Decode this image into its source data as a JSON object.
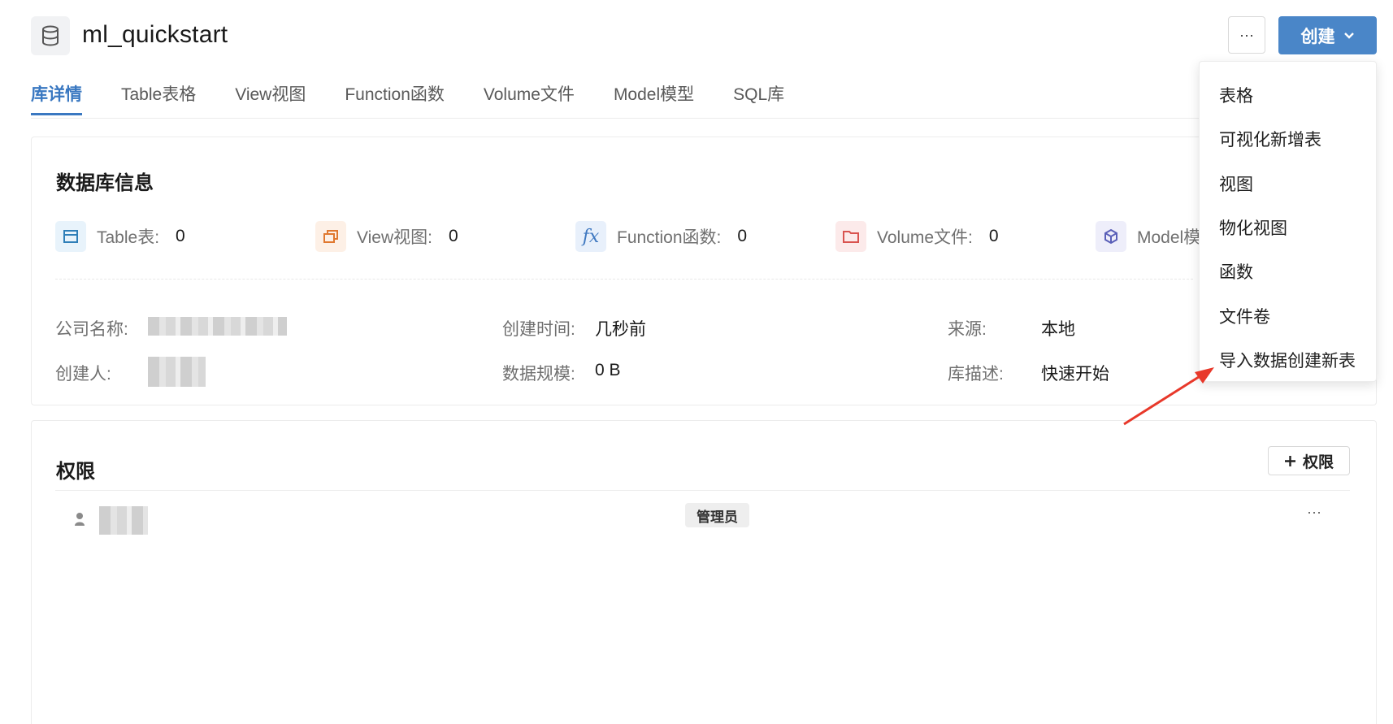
{
  "header": {
    "title": "ml_quickstart",
    "more_label": "···",
    "create_label": "创建"
  },
  "tabs": [
    {
      "label": "库详情",
      "active": true
    },
    {
      "label": "Table表格",
      "active": false
    },
    {
      "label": "View视图",
      "active": false
    },
    {
      "label": "Function函数",
      "active": false
    },
    {
      "label": "Volume文件",
      "active": false
    },
    {
      "label": "Model模型",
      "active": false
    },
    {
      "label": "SQL库",
      "active": false
    }
  ],
  "info": {
    "title": "数据库信息",
    "stats": [
      {
        "label": "Table表:",
        "value": "0",
        "icon": "table-icon",
        "color": "#2f7fb8",
        "bg": "#e8f3fb"
      },
      {
        "label": "View视图:",
        "value": "0",
        "icon": "view-icon",
        "color": "#e0782f",
        "bg": "#fdf0e6"
      },
      {
        "label": "Function函数:",
        "value": "0",
        "icon": "function-icon",
        "color": "#3f78c0",
        "bg": "#e8f0fb"
      },
      {
        "label": "Volume文件:",
        "value": "0",
        "icon": "folder-icon",
        "color": "#d9534f",
        "bg": "#fceaea"
      },
      {
        "label": "Model模",
        "value": "",
        "icon": "cube-icon",
        "color": "#5a5fb8",
        "bg": "#eeeefa"
      }
    ],
    "fields": {
      "company_label": "公司名称:",
      "creator_label": "创建人:",
      "created_time_label": "创建时间:",
      "created_time_value": "几秒前",
      "data_size_label": "数据规模:",
      "data_size_value": "0 B",
      "source_label": "来源:",
      "source_value": "本地",
      "description_label": "库描述:",
      "description_value": "快速开始"
    }
  },
  "permissions": {
    "title": "权限",
    "add_label": "权限",
    "rows": [
      {
        "role": "管理员"
      }
    ],
    "more_label": "···"
  },
  "create_menu": {
    "items": [
      "表格",
      "可视化新增表",
      "视图",
      "物化视图",
      "函数",
      "文件卷",
      "导入数据创建新表"
    ]
  },
  "colors": {
    "accent": "#3a78c1",
    "primary_button": "#4a86c8",
    "annotation_arrow": "#e8382a"
  }
}
